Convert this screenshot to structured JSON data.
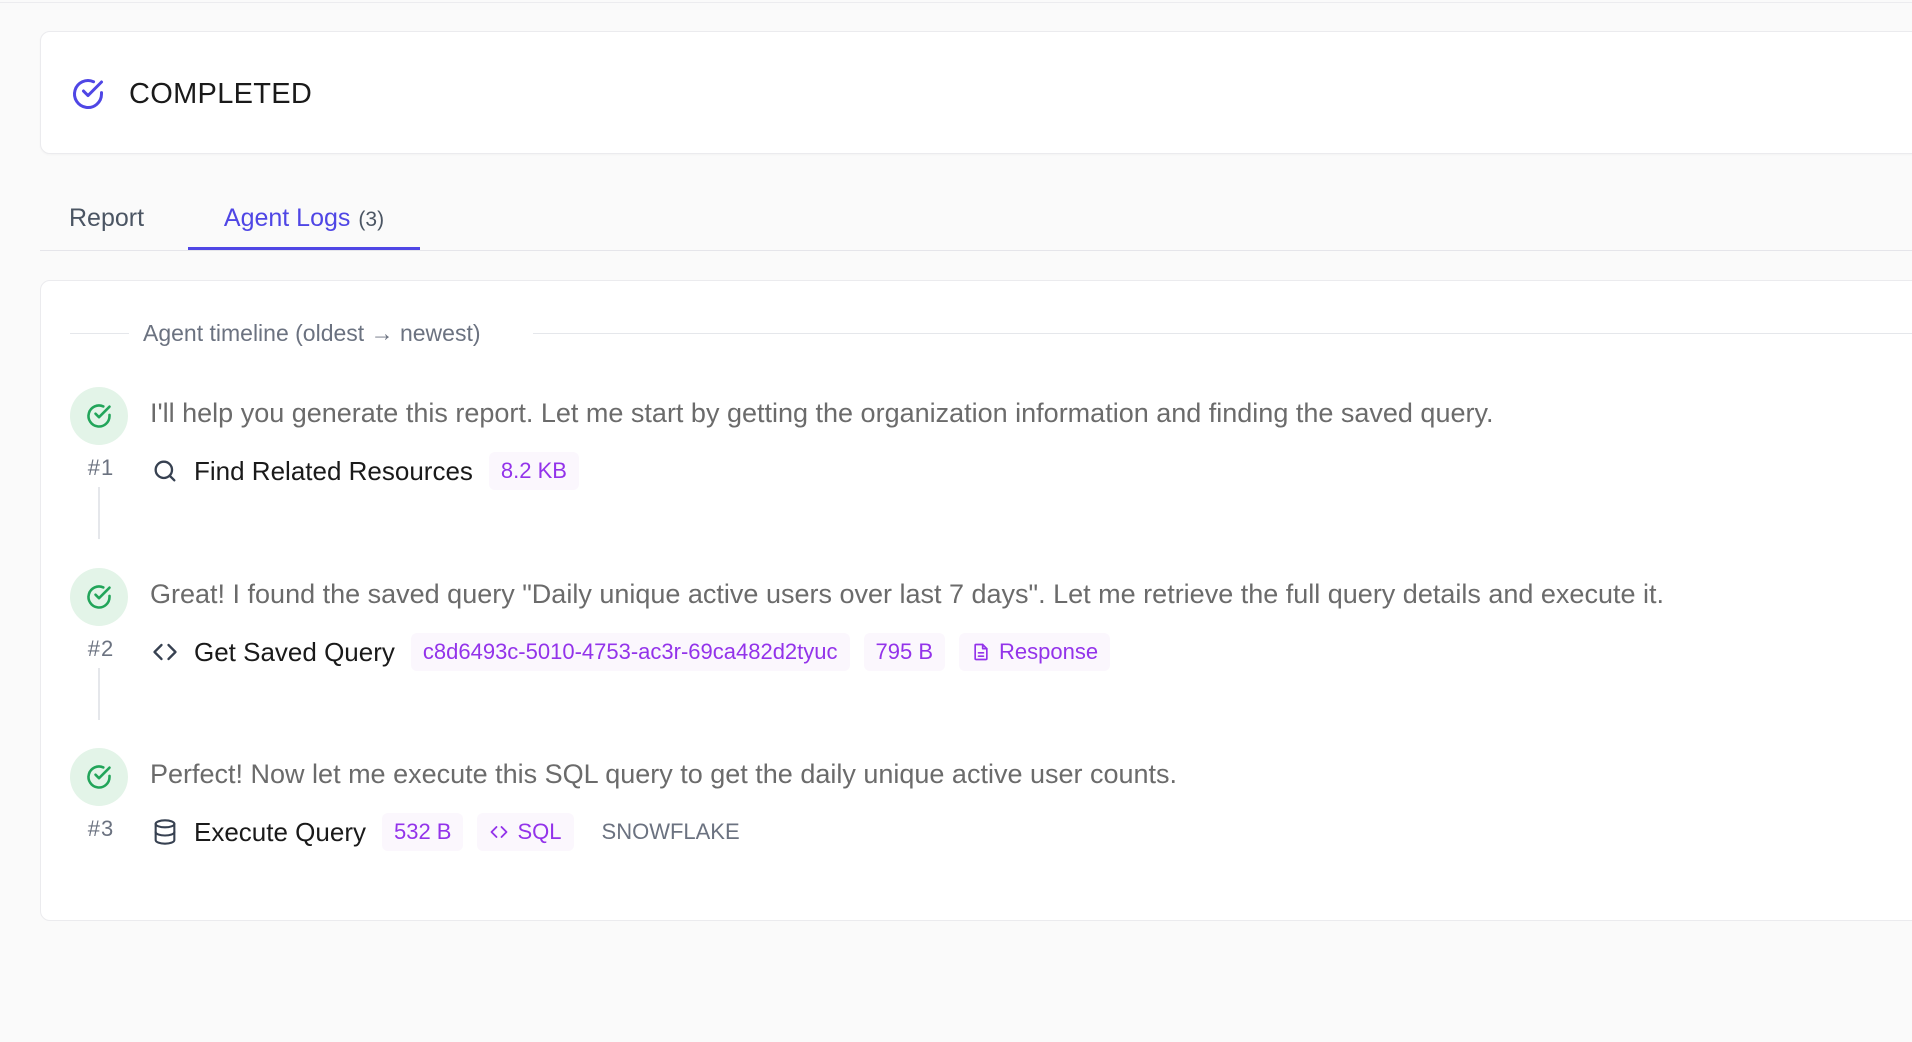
{
  "status": {
    "label": "COMPLETED",
    "icon": "check-circle-icon",
    "color": "#4f46e5"
  },
  "tabs": [
    {
      "label": "Report",
      "active": false
    },
    {
      "label": "Agent Logs",
      "count": "(3)",
      "active": true
    }
  ],
  "timeline": {
    "header": "Agent timeline (oldest → newest)",
    "steps": [
      {
        "number": "#1",
        "message": "I'll help you generate this report. Let me start by getting the organization information and finding the saved query.",
        "action": {
          "icon": "search-icon",
          "name": "Find Related Resources"
        },
        "chips": [
          "8.2 KB"
        ]
      },
      {
        "number": "#2",
        "message": "Great! I found the saved query \"Daily unique active users over last 7 days\". Let me retrieve the full query details and execute it.",
        "action": {
          "icon": "code-icon",
          "name": "Get Saved Query"
        },
        "chips": [
          "c8d6493c-5010-4753-ac3r-69ca482d2tyuc",
          "795 B",
          "Response"
        ]
      },
      {
        "number": "#3",
        "message": "Perfect! Now let me execute this SQL query to get the daily unique active user counts.",
        "action": {
          "icon": "database-icon",
          "name": "Execute Query"
        },
        "chips": [
          "532 B",
          "SQL"
        ],
        "tag": "SNOWFLAKE"
      }
    ]
  },
  "colors": {
    "accent": "#4f46e5",
    "success": "#22a55a",
    "chip_text": "#9333ea"
  }
}
